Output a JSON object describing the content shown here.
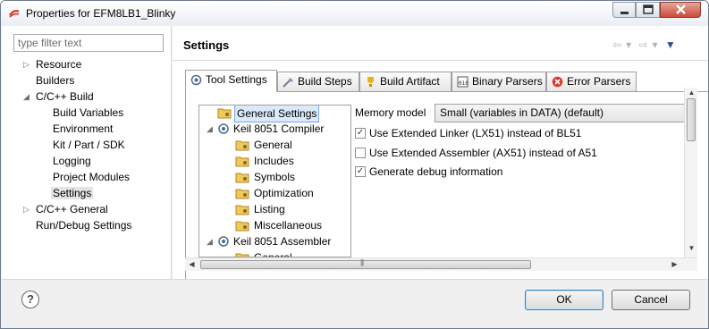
{
  "window": {
    "title": "Properties for EFM8LB1_Blinky",
    "colors": {
      "close_button": "#c94a36",
      "selection": "#dbe9fb",
      "accent": "#2f4f8a"
    }
  },
  "filter": {
    "placeholder": "type filter text"
  },
  "nav_tree": [
    {
      "label": "Resource",
      "expandable": true
    },
    {
      "label": "Builders",
      "expandable": false
    },
    {
      "label": "C/C++ Build",
      "expandable": true,
      "expanded": true
    },
    {
      "label": "Build Variables"
    },
    {
      "label": "Environment"
    },
    {
      "label": "Kit / Part / SDK"
    },
    {
      "label": "Logging"
    },
    {
      "label": "Project Modules"
    },
    {
      "label": "Settings",
      "selected": true
    },
    {
      "label": "C/C++ General",
      "expandable": true
    },
    {
      "label": "Run/Debug Settings"
    }
  ],
  "page": {
    "title": "Settings",
    "nav_icons": [
      "back-arrow-icon",
      "dropdown-icon",
      "forward-arrow-icon",
      "dropdown-icon",
      "view-menu-icon"
    ]
  },
  "tabs": [
    {
      "label": "Tool Settings",
      "icon": "tool-settings-icon",
      "active": true
    },
    {
      "label": "Build Steps",
      "icon": "build-steps-icon"
    },
    {
      "label": "Build Artifact",
      "icon": "build-artifact-icon"
    },
    {
      "label": "Binary Parsers",
      "icon": "binary-parsers-icon"
    },
    {
      "label": "Error Parsers",
      "icon": "error-parsers-icon"
    }
  ],
  "tool_tree": [
    {
      "label": "General Settings",
      "selected": true
    },
    {
      "label": "Keil 8051 Compiler",
      "expanded": true
    },
    {
      "label": "General"
    },
    {
      "label": "Includes"
    },
    {
      "label": "Symbols"
    },
    {
      "label": "Optimization"
    },
    {
      "label": "Listing"
    },
    {
      "label": "Miscellaneous"
    },
    {
      "label": "Keil 8051 Assembler",
      "expanded": true
    },
    {
      "label": "General"
    }
  ],
  "settings": {
    "memory_model_label": "Memory model",
    "memory_model_value": "Small (variables in DATA) (default)",
    "options": [
      {
        "label": "Use Extended Linker (LX51) instead of BL51",
        "checked": true
      },
      {
        "label": "Use Extended Assembler (AX51) instead of A51",
        "checked": false
      },
      {
        "label": "Generate debug information",
        "checked": true
      }
    ]
  },
  "buttons": {
    "ok": "OK",
    "cancel": "Cancel",
    "help": "?"
  }
}
